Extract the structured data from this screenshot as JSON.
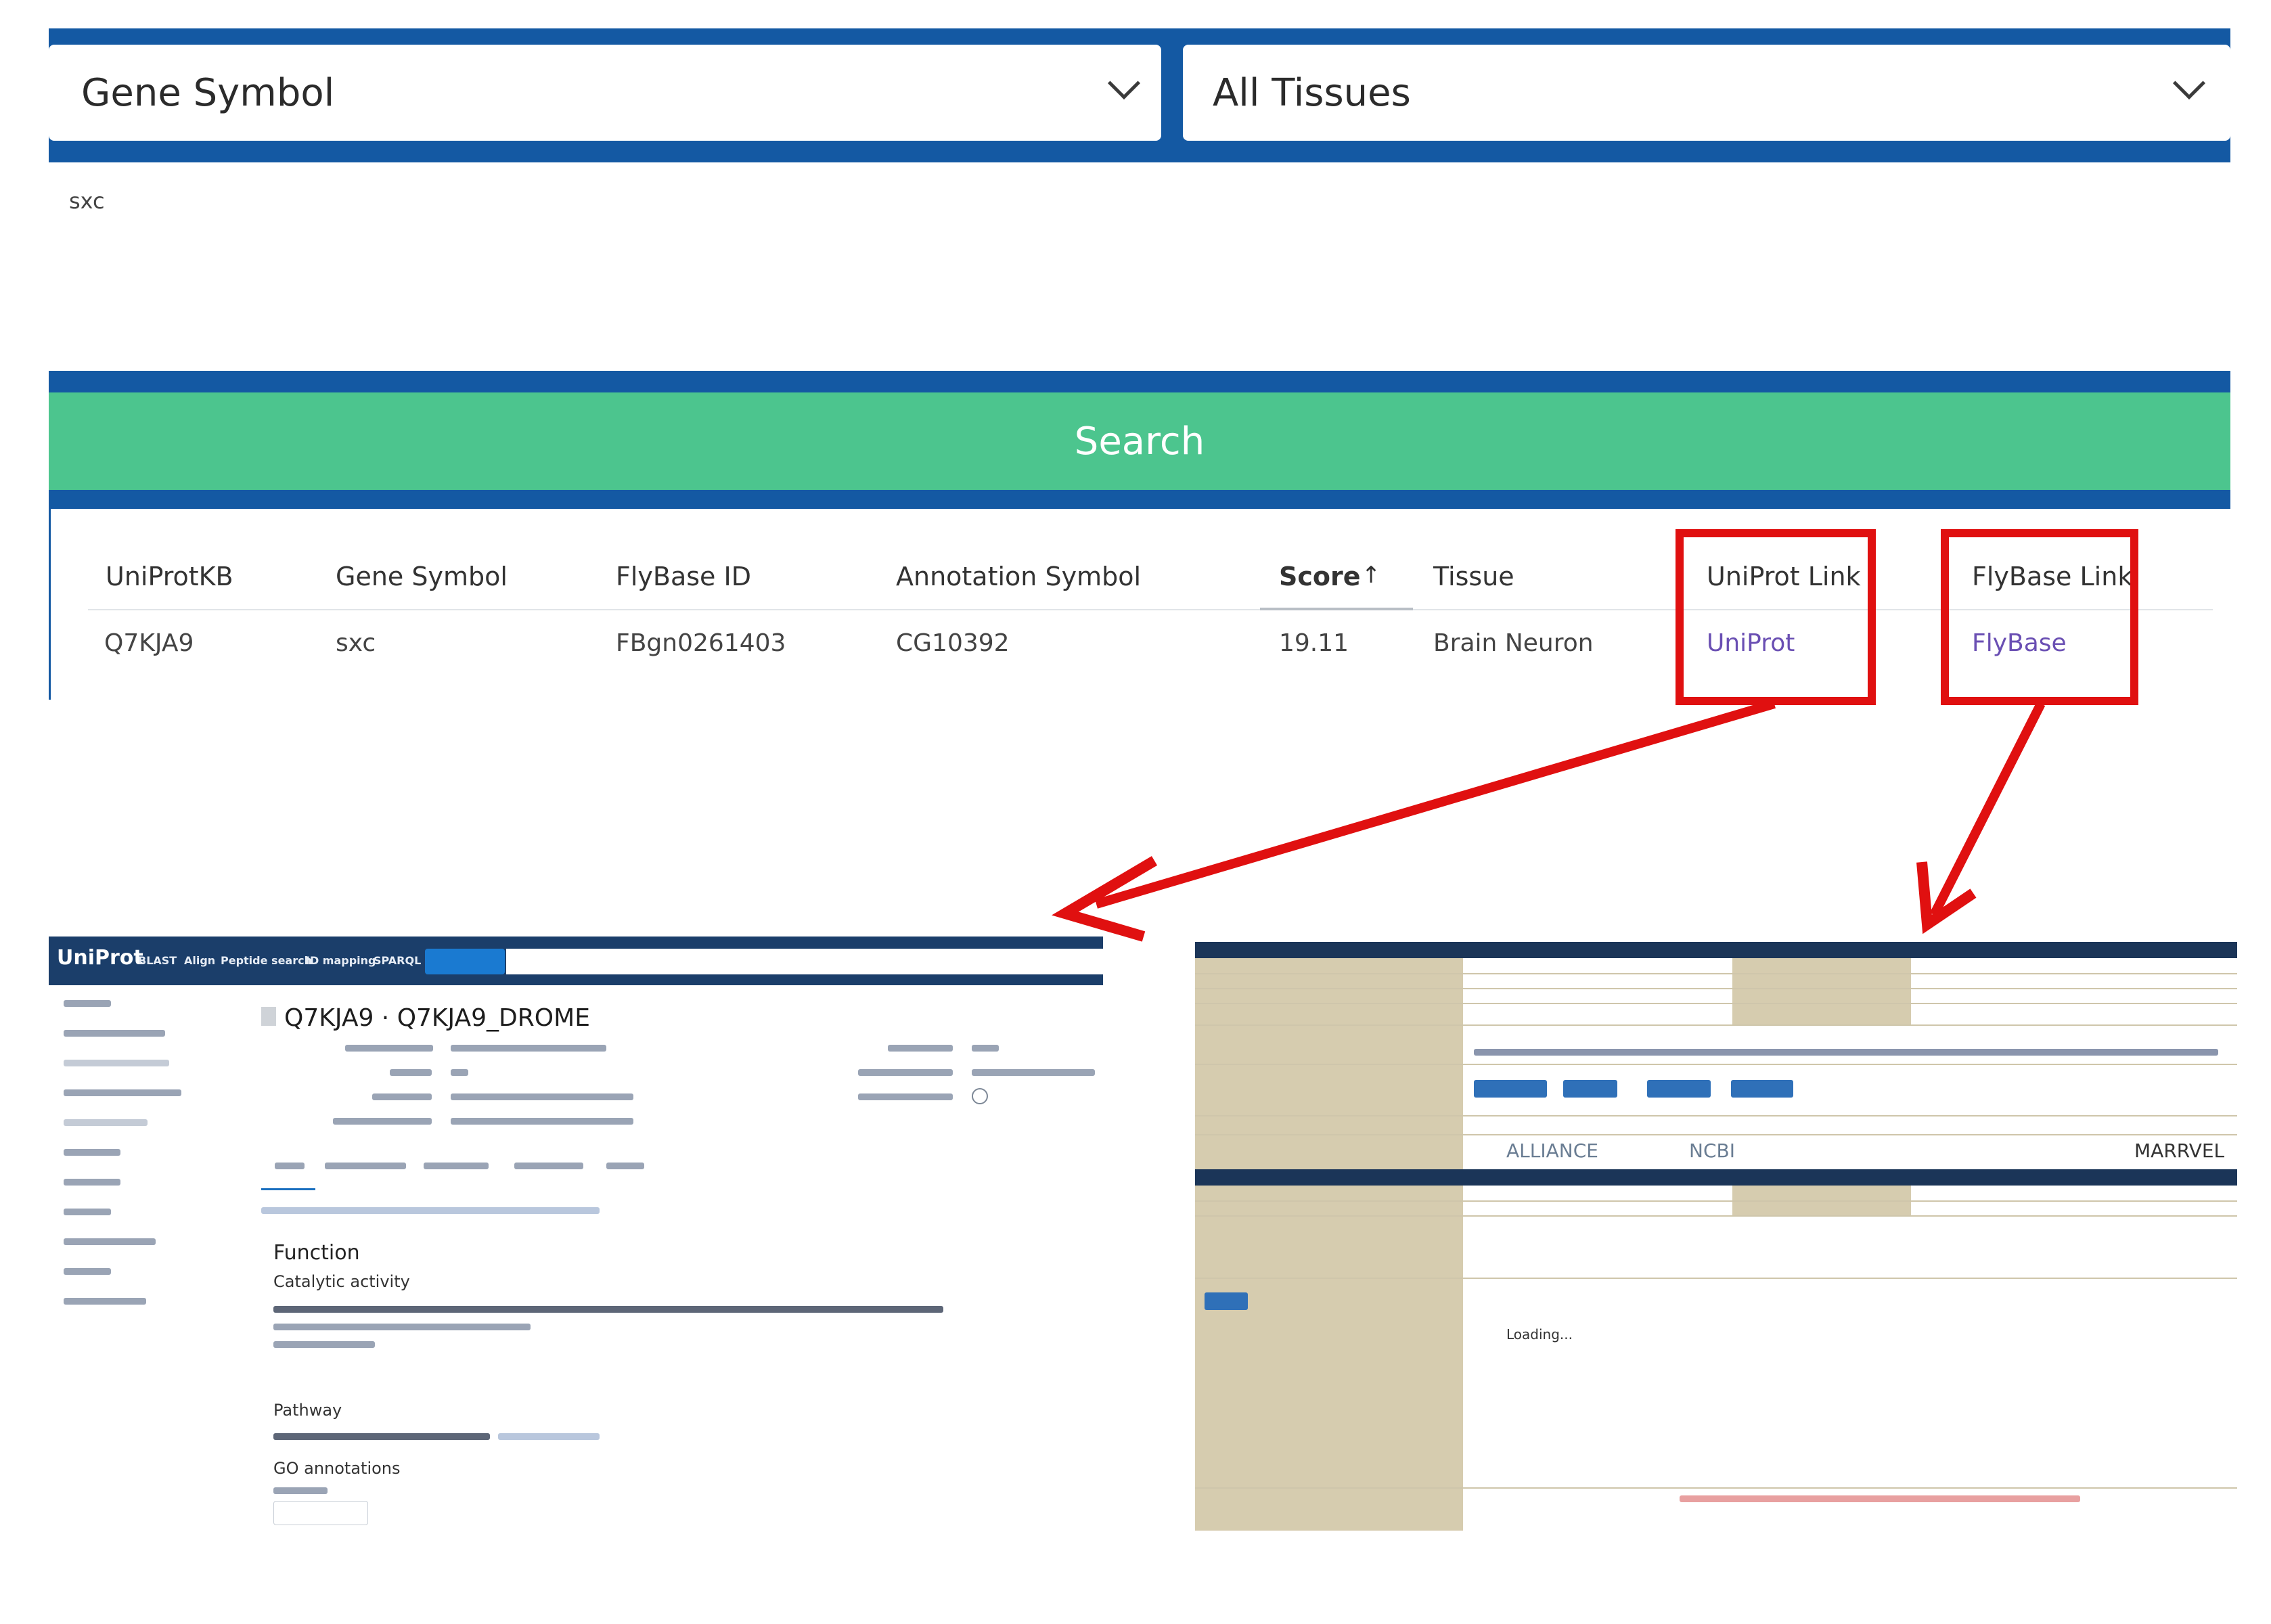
{
  "search": {
    "field_select": "Gene Symbol",
    "tissue_select": "All Tissues",
    "query_value": "sxc",
    "button_label": "Search"
  },
  "results": {
    "columns": [
      "UniProtKB",
      "Gene Symbol",
      "FlyBase ID",
      "Annotation Symbol",
      "Score",
      "Tissue",
      "UniProt Link",
      "FlyBase Link"
    ],
    "sort_indicator": "↑",
    "rows": [
      [
        "Q7KJA9",
        "sxc",
        "FBgn0261403",
        "CG10392",
        "19.11",
        "Brain Neuron",
        "UniProt",
        "FlyBase"
      ]
    ]
  },
  "uniprot_preview": {
    "logo": "UniProt",
    "nav": [
      "BLAST",
      "Align",
      "Peptide search",
      "ID mapping",
      "SPARQL"
    ],
    "title": "Q7KJA9 · Q7KJA9_DROME",
    "sections": {
      "function": "Function",
      "catalytic": "Catalytic activity",
      "pathway": "Pathway",
      "go": "GO annotations"
    }
  },
  "flybase_preview": {
    "loading": "Loading...",
    "logos": [
      "ALLIANCE",
      "NCBI",
      "MARRVEL"
    ]
  },
  "colors": {
    "panel_blue": "#1459a3",
    "search_green": "#4cc58e",
    "highlight_red": "#e01010",
    "link_purple": "#6a4fb3"
  }
}
